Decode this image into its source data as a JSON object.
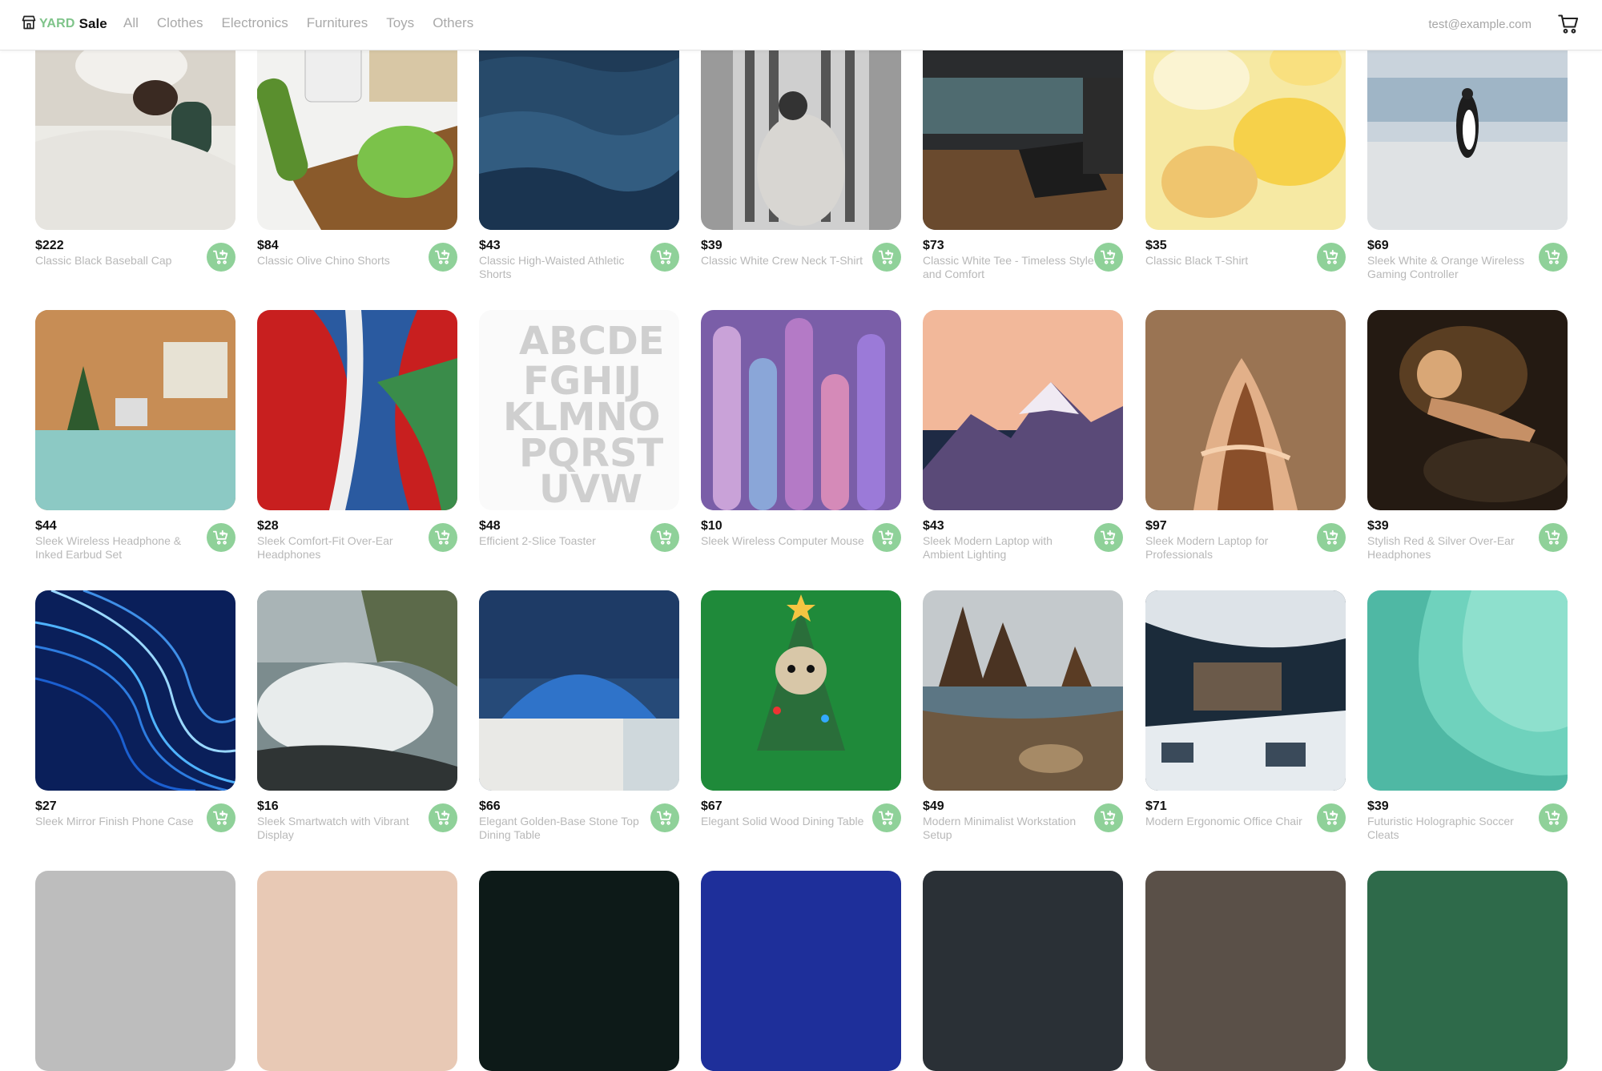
{
  "brand": {
    "yard": "YARD",
    "sale": "Sale",
    "logo_icon": "storefront-icon"
  },
  "nav": [
    "All",
    "Clothes",
    "Electronics",
    "Furnitures",
    "Toys",
    "Others"
  ],
  "user": {
    "email": "test@example.com",
    "cart_icon": "shopping-cart-icon"
  },
  "colors": {
    "accent": "#8fd199",
    "brand_green": "#7fc48a",
    "muted_text": "#b8b8b8"
  },
  "products": [
    {
      "price": "$222",
      "title": "Classic Black Baseball Cap",
      "image": "woman-sleeping-in-bed"
    },
    {
      "price": "$84",
      "title": "Classic Olive Chino Shorts",
      "image": "vegetables-on-cutting-board"
    },
    {
      "price": "$43",
      "title": "Classic High-Waisted Athletic Shorts",
      "image": "ocean-waves"
    },
    {
      "price": "$39",
      "title": "Classic White Crew Neck T-Shirt",
      "image": "photographer-at-skyscraper"
    },
    {
      "price": "$73",
      "title": "Classic White Tee - Timeless Style and Comfort",
      "image": "person-with-laptop-office"
    },
    {
      "price": "$35",
      "title": "Classic Black T-Shirt",
      "image": "yellow-abstract-paint"
    },
    {
      "price": "$69",
      "title": "Sleek White & Orange Wireless Gaming Controller",
      "image": "penguin-on-beach"
    },
    {
      "price": "$44",
      "title": "Sleek Wireless Headphone & Inked Earbud Set",
      "image": "retro-living-room"
    },
    {
      "price": "$28",
      "title": "Sleek Comfort-Fit Over-Ear Headphones",
      "image": "red-blue-abstract-paint"
    },
    {
      "price": "$48",
      "title": "Efficient 2-Slice Toaster",
      "image": "distorted-alphabet-letters"
    },
    {
      "price": "$10",
      "title": "Sleek Wireless Computer Mouse",
      "image": "purple-cylinders-3d"
    },
    {
      "price": "$43",
      "title": "Sleek Modern Laptop with Ambient Lighting",
      "image": "snowy-mountains-sunset"
    },
    {
      "price": "$97",
      "title": "Sleek Modern Laptop for Professionals",
      "image": "copper-liquid-figure"
    },
    {
      "price": "$39",
      "title": "Stylish Red & Silver Over-Ear Headphones",
      "image": "woman-resting-dark"
    },
    {
      "price": "$27",
      "title": "Sleek Mirror Finish Phone Case",
      "image": "blue-light-waves"
    },
    {
      "price": "$16",
      "title": "Sleek Smartwatch with Vibrant Display",
      "image": "waves-crashing-cliff"
    },
    {
      "price": "$66",
      "title": "Elegant Golden-Base Stone Top Dining Table",
      "image": "blue-dome-santorini"
    },
    {
      "price": "$67",
      "title": "Elegant Solid Wood Dining Table",
      "image": "dog-in-christmas-tree-costume"
    },
    {
      "price": "$49",
      "title": "Modern Minimalist Workstation Setup",
      "image": "rocky-beach"
    },
    {
      "price": "$71",
      "title": "Modern Ergonomic Office Chair",
      "image": "snowy-village"
    },
    {
      "price": "$39",
      "title": "Futuristic Holographic Soccer Cleats",
      "image": "teal-abstract-curve"
    }
  ],
  "add_to_cart_icon": "add-to-cart-icon"
}
